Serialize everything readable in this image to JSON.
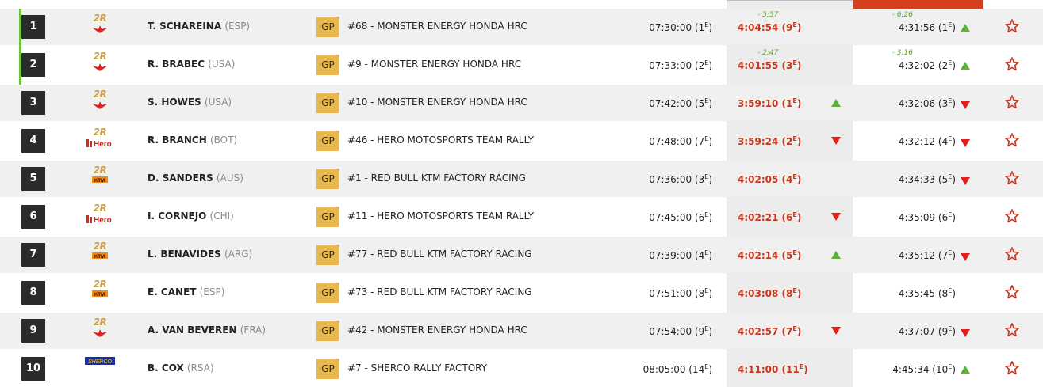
{
  "header": {
    "accent_color": "#d3401e"
  },
  "rows": [
    {
      "rank": "1",
      "category": "2R",
      "brand": "honda",
      "rider": "T. SCHAREINA",
      "nat": "(ESP)",
      "class": "GP",
      "team": "#68 - MONSTER ENERGY HONDA HRC",
      "start": "07:30:00 (1",
      "start_pos": "E",
      "stage_gap": "- 5:57",
      "stage_time": "4:04:54 (9",
      "stage_pos": "E",
      "stage_trend": "none",
      "overall_gap": "- 6:26",
      "overall_time": "4:31:56 (1",
      "overall_pos": "E",
      "overall_trend": "up",
      "leader": true
    },
    {
      "rank": "2",
      "category": "2R",
      "brand": "honda",
      "rider": "R. BRABEC",
      "nat": "(USA)",
      "class": "GP",
      "team": "#9 - MONSTER ENERGY HONDA HRC",
      "start": "07:33:00 (2",
      "start_pos": "E",
      "stage_gap": "- 2:47",
      "stage_time": "4:01:55 (3",
      "stage_pos": "E",
      "stage_trend": "none",
      "overall_gap": "- 3:16",
      "overall_time": "4:32:02 (2",
      "overall_pos": "E",
      "overall_trend": "up",
      "leader": true
    },
    {
      "rank": "3",
      "category": "2R",
      "brand": "honda",
      "rider": "S. HOWES",
      "nat": "(USA)",
      "class": "GP",
      "team": "#10 - MONSTER ENERGY HONDA HRC",
      "start": "07:42:00 (5",
      "start_pos": "E",
      "stage_gap": "",
      "stage_time": "3:59:10 (1",
      "stage_pos": "E",
      "stage_trend": "up",
      "overall_gap": "",
      "overall_time": "4:32:06 (3",
      "overall_pos": "E",
      "overall_trend": "down",
      "leader": false
    },
    {
      "rank": "4",
      "category": "2R",
      "brand": "hero",
      "rider": "R. BRANCH",
      "nat": "(BOT)",
      "class": "GP",
      "team": "#46 - HERO MOTOSPORTS TEAM RALLY",
      "start": "07:48:00 (7",
      "start_pos": "E",
      "stage_gap": "",
      "stage_time": "3:59:24 (2",
      "stage_pos": "E",
      "stage_trend": "down",
      "overall_gap": "",
      "overall_time": "4:32:12 (4",
      "overall_pos": "E",
      "overall_trend": "down",
      "leader": false
    },
    {
      "rank": "5",
      "category": "2R",
      "brand": "ktm",
      "rider": "D. SANDERS",
      "nat": "(AUS)",
      "class": "GP",
      "team": "#1 - RED BULL KTM FACTORY RACING",
      "start": "07:36:00 (3",
      "start_pos": "E",
      "stage_gap": "",
      "stage_time": "4:02:05 (4",
      "stage_pos": "E",
      "stage_trend": "none",
      "overall_gap": "",
      "overall_time": "4:34:33 (5",
      "overall_pos": "E",
      "overall_trend": "down",
      "leader": false
    },
    {
      "rank": "6",
      "category": "2R",
      "brand": "hero",
      "rider": "I. CORNEJO",
      "nat": "(CHI)",
      "class": "GP",
      "team": "#11 - HERO MOTOSPORTS TEAM RALLY",
      "start": "07:45:00 (6",
      "start_pos": "E",
      "stage_gap": "",
      "stage_time": "4:02:21 (6",
      "stage_pos": "E",
      "stage_trend": "down",
      "overall_gap": "",
      "overall_time": "4:35:09 (6",
      "overall_pos": "E",
      "overall_trend": "none",
      "leader": false
    },
    {
      "rank": "7",
      "category": "2R",
      "brand": "ktm",
      "rider": "L. BENAVIDES",
      "nat": "(ARG)",
      "class": "GP",
      "team": "#77 - RED BULL KTM FACTORY RACING",
      "start": "07:39:00 (4",
      "start_pos": "E",
      "stage_gap": "",
      "stage_time": "4:02:14 (5",
      "stage_pos": "E",
      "stage_trend": "up",
      "overall_gap": "",
      "overall_time": "4:35:12 (7",
      "overall_pos": "E",
      "overall_trend": "down",
      "leader": false
    },
    {
      "rank": "8",
      "category": "2R",
      "brand": "ktm",
      "rider": "E. CANET",
      "nat": "(ESP)",
      "class": "GP",
      "team": "#73 - RED BULL KTM FACTORY RACING",
      "start": "07:51:00 (8",
      "start_pos": "E",
      "stage_gap": "",
      "stage_time": "4:03:08 (8",
      "stage_pos": "E",
      "stage_trend": "none",
      "overall_gap": "",
      "overall_time": "4:35:45 (8",
      "overall_pos": "E",
      "overall_trend": "none",
      "leader": false
    },
    {
      "rank": "9",
      "category": "2R",
      "brand": "honda",
      "rider": "A. VAN BEVEREN",
      "nat": "(FRA)",
      "class": "GP",
      "team": "#42 - MONSTER ENERGY HONDA HRC",
      "start": "07:54:00 (9",
      "start_pos": "E",
      "stage_gap": "",
      "stage_time": "4:02:57 (7",
      "stage_pos": "E",
      "stage_trend": "down",
      "overall_gap": "",
      "overall_time": "4:37:07 (9",
      "overall_pos": "E",
      "overall_trend": "down",
      "leader": false
    },
    {
      "rank": "10",
      "category": "",
      "brand": "sherco",
      "rider": "B. COX",
      "nat": "(RSA)",
      "class": "GP",
      "team": "#7 - SHERCO RALLY FACTORY",
      "start": "08:05:00 (14",
      "start_pos": "E",
      "stage_gap": "",
      "stage_time": "4:11:00 (11",
      "stage_pos": "E",
      "stage_trend": "none",
      "overall_gap": "",
      "overall_time": "4:45:34 (10",
      "overall_pos": "E",
      "overall_trend": "up",
      "leader": false
    }
  ],
  "colors": {
    "gp_badge": "#e7b84f",
    "stage_time": "#c8371b",
    "up": "#5bb33a",
    "down": "#e0201a",
    "leader": "#6fc33c"
  }
}
